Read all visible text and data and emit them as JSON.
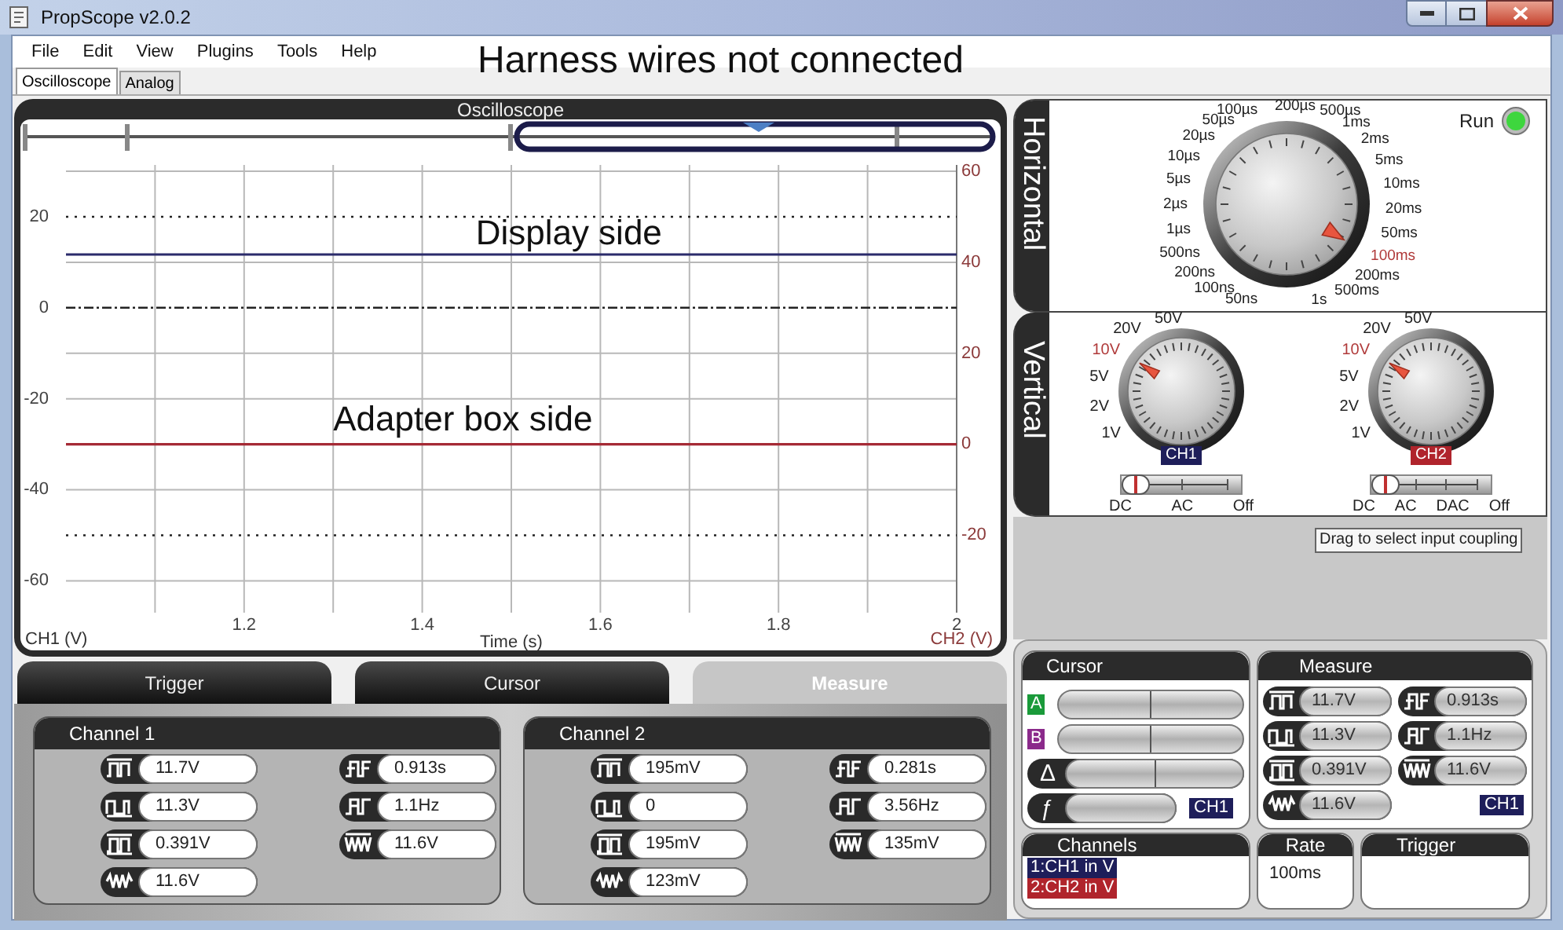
{
  "window": {
    "title": "PropScope v2.0.2"
  },
  "menu": [
    "File",
    "Edit",
    "View",
    "Plugins",
    "Tools",
    "Help"
  ],
  "note": "Harness wires not connected",
  "tabs": [
    {
      "label": "Oscilloscope",
      "selected": true
    },
    {
      "label": "Analog",
      "selected": false
    }
  ],
  "scope": {
    "title": "Oscilloscope",
    "chart_data": {
      "type": "line",
      "xlabel": "Time (s)",
      "ylabel": "CH1 (V)",
      "y2label": "CH2 (V)",
      "x": [
        1.0,
        2.0
      ],
      "xlim": [
        1.0,
        2.0
      ],
      "ylim": [
        -67,
        30
      ],
      "y2lim": [
        -37,
        60
      ],
      "xticks": [
        1.2,
        1.4,
        1.6,
        1.8,
        2
      ],
      "yticks": [
        20,
        0,
        -20,
        -40,
        -60
      ],
      "y2ticks": [
        60,
        40,
        20,
        0,
        -20
      ],
      "series": [
        {
          "color": "#2b2b6b",
          "values": [
            11.7,
            11.7
          ]
        },
        {
          "color": "#a52a35",
          "axis": "y2",
          "values": [
            0,
            0
          ]
        }
      ],
      "grid": true,
      "annotations": [
        "Display side",
        "Adapter box side"
      ]
    }
  },
  "horizontal": {
    "title": "Horizontal",
    "run": {
      "label": "Run",
      "on": true
    },
    "dial": {
      "left": [
        {
          "text": "100µs",
          "selected": false
        },
        {
          "text": "50µs",
          "selected": false
        },
        {
          "text": "20µs",
          "selected": false
        },
        {
          "text": "10µs",
          "selected": false
        },
        {
          "text": "5µs",
          "selected": false
        },
        {
          "text": "2µs",
          "selected": false
        },
        {
          "text": "1µs",
          "selected": false
        },
        {
          "text": "500ns",
          "selected": false
        },
        {
          "text": "200ns",
          "selected": false
        },
        {
          "text": "100ns",
          "selected": false
        },
        {
          "text": "50ns",
          "selected": false
        }
      ],
      "right": [
        {
          "text": "200µs",
          "selected": false
        },
        {
          "text": "500µs",
          "selected": false
        },
        {
          "text": "1ms",
          "selected": false
        },
        {
          "text": "2ms",
          "selected": false
        },
        {
          "text": "5ms",
          "selected": false
        },
        {
          "text": "10ms",
          "selected": false
        },
        {
          "text": "20ms",
          "selected": false
        },
        {
          "text": "50ms",
          "selected": false
        },
        {
          "text": "100ms",
          "selected": true
        },
        {
          "text": "200ms",
          "selected": false
        },
        {
          "text": "500ms",
          "selected": false
        },
        {
          "text": "1s",
          "selected": false
        }
      ]
    }
  },
  "vertical": {
    "title": "Vertical",
    "channels": [
      {
        "name": "CH1",
        "color": "#1e1e5a",
        "dial": [
          {
            "text": "50V",
            "selected": false
          },
          {
            "text": "20V",
            "selected": false
          },
          {
            "text": "10V",
            "selected": true
          },
          {
            "text": "5V",
            "selected": false
          },
          {
            "text": "2V",
            "selected": false
          },
          {
            "text": "1V",
            "selected": false
          }
        ],
        "coupling": [
          {
            "label": "DC",
            "selected": true
          },
          {
            "label": "AC",
            "selected": false
          },
          {
            "label": "Off",
            "selected": false
          }
        ]
      },
      {
        "name": "CH2",
        "color": "#b0242c",
        "dial": [
          {
            "text": "50V",
            "selected": false
          },
          {
            "text": "20V",
            "selected": false
          },
          {
            "text": "10V",
            "selected": true
          },
          {
            "text": "5V",
            "selected": false
          },
          {
            "text": "2V",
            "selected": false
          },
          {
            "text": "1V",
            "selected": false
          }
        ],
        "coupling": [
          {
            "label": "DC",
            "selected": true
          },
          {
            "label": "AC",
            "selected": false
          },
          {
            "label": "DAC",
            "selected": false
          },
          {
            "label": "Off",
            "selected": false
          }
        ]
      }
    ],
    "tooltip": "Drag to select input coupling"
  },
  "bottom_tabs": [
    {
      "label": "Trigger",
      "selected": false
    },
    {
      "label": "Cursor",
      "selected": false
    },
    {
      "label": "Measure",
      "selected": true
    }
  ],
  "measure_panel": [
    {
      "title": "Channel 1",
      "columns": [
        [
          {
            "kind": "max",
            "value": "11.7V"
          },
          {
            "kind": "min",
            "value": "11.3V"
          },
          {
            "kind": "pp",
            "value": "0.391V"
          },
          {
            "kind": "rms",
            "value": "11.6V"
          }
        ],
        [
          {
            "kind": "period",
            "value": "0.913s"
          },
          {
            "kind": "freq",
            "value": "1.1Hz"
          },
          {
            "kind": "amp",
            "value": "11.6V"
          }
        ]
      ]
    },
    {
      "title": "Channel 2",
      "columns": [
        [
          {
            "kind": "max",
            "value": "195mV"
          },
          {
            "kind": "min",
            "value": "0"
          },
          {
            "kind": "pp",
            "value": "195mV"
          },
          {
            "kind": "rms",
            "value": "123mV"
          }
        ],
        [
          {
            "kind": "period",
            "value": "0.281s"
          },
          {
            "kind": "freq",
            "value": "3.56Hz"
          },
          {
            "kind": "amp",
            "value": "135mV"
          }
        ]
      ]
    }
  ],
  "cursor": {
    "title": "Cursor",
    "rows": [
      {
        "kind": "marker",
        "label": "A",
        "color": "#1a9a3a"
      },
      {
        "kind": "marker",
        "label": "B",
        "color": "#8b2a8b"
      },
      {
        "kind": "delta",
        "label": "Δ"
      },
      {
        "kind": "function",
        "label": "ƒ",
        "channel": "CH1"
      }
    ]
  },
  "measure_summary": {
    "title": "Measure",
    "channel": "CH1",
    "columns": [
      [
        {
          "kind": "max",
          "value": "11.7V"
        },
        {
          "kind": "min",
          "value": "11.3V"
        },
        {
          "kind": "pp",
          "value": "0.391V"
        },
        {
          "kind": "rms",
          "value": "11.6V"
        }
      ],
      [
        {
          "kind": "period",
          "value": "0.913s"
        },
        {
          "kind": "freq",
          "value": "1.1Hz"
        },
        {
          "kind": "amp",
          "value": "11.6V"
        }
      ]
    ]
  },
  "channels": {
    "title": "Channels",
    "items": [
      {
        "label": "1:CH1 in V",
        "color": "#1e1e5a"
      },
      {
        "label": "2:CH2 in V",
        "color": "#b0242c"
      }
    ]
  },
  "rate": {
    "title": "Rate",
    "value": "100ms"
  },
  "trigger": {
    "title": "Trigger"
  }
}
